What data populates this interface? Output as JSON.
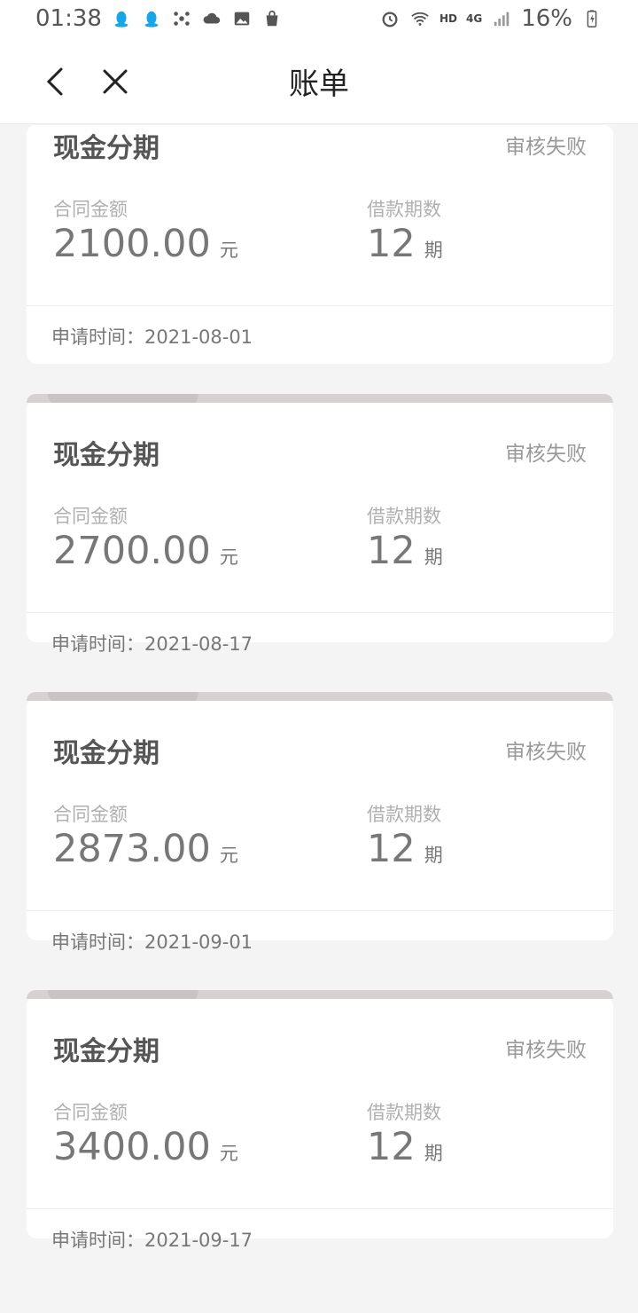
{
  "status_bar": {
    "time": "01:38",
    "net": "HD",
    "signal": "4G",
    "battery": "16%",
    "left_icons": [
      "qq-icon",
      "qq-icon",
      "network-icon",
      "cloud-sync-icon",
      "image-icon",
      "shopping-bag-icon"
    ],
    "right_icons": [
      "alarm-icon",
      "wifi-icon",
      "signal-icon",
      "battery-icon"
    ]
  },
  "header": {
    "title": "账单"
  },
  "labels": {
    "amount": "合同金额",
    "periods": "借款期数",
    "amount_unit": "元",
    "period_unit": "期"
  },
  "bills": [
    {
      "title": "现金分期",
      "status": "审核失败",
      "amount": "2100.00",
      "periods": "12",
      "apply_time": "申请时间：2021-08-01"
    },
    {
      "title": "现金分期",
      "status": "审核失败",
      "amount": "2700.00",
      "periods": "12",
      "apply_time": "申请时间：2021-08-17"
    },
    {
      "title": "现金分期",
      "status": "审核失败",
      "amount": "2873.00",
      "periods": "12",
      "apply_time": "申请时间：2021-09-01"
    },
    {
      "title": "现金分期",
      "status": "审核失败",
      "amount": "3400.00",
      "periods": "12",
      "apply_time": "申请时间：2021-09-17"
    }
  ],
  "colors": {
    "background": "#f4f4f4",
    "card": "#ffffff",
    "status_text": "#999999",
    "tab": "#d6d2d2"
  }
}
